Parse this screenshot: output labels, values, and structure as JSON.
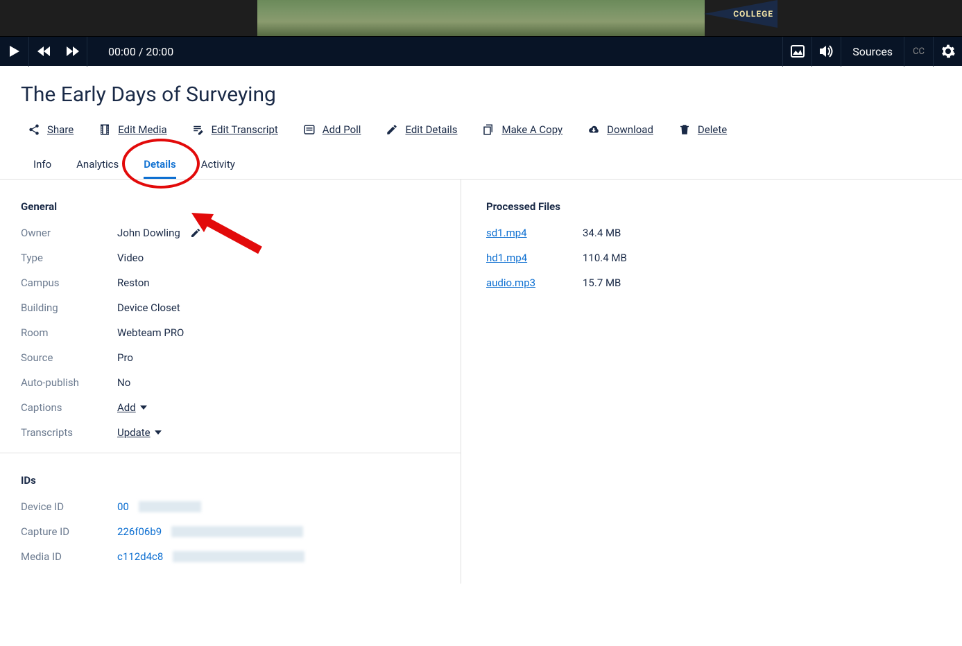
{
  "thumb": {
    "pennant": "COLLEGE"
  },
  "player": {
    "time": "00:00 / 20:00",
    "sources": "Sources",
    "cc": "CC"
  },
  "title": "The Early Days of Surveying",
  "actions": {
    "share": "Share",
    "edit_media": "Edit Media",
    "edit_transcript": "Edit Transcript",
    "add_poll": "Add Poll",
    "edit_details": "Edit Details",
    "make_copy": "Make A Copy",
    "download": "Download",
    "delete": "Delete"
  },
  "tabs": {
    "info": "Info",
    "analytics": "Analytics",
    "details": "Details",
    "activity": "Activity"
  },
  "general": {
    "heading": "General",
    "owner_label": "Owner",
    "owner_value": "John Dowling",
    "type_label": "Type",
    "type_value": "Video",
    "campus_label": "Campus",
    "campus_value": "Reston",
    "building_label": "Building",
    "building_value": "Device Closet",
    "room_label": "Room",
    "room_value": "Webteam PRO",
    "source_label": "Source",
    "source_value": "Pro",
    "autopub_label": "Auto-publish",
    "autopub_value": "No",
    "captions_label": "Captions",
    "captions_action": "Add",
    "transcripts_label": "Transcripts",
    "transcripts_action": "Update"
  },
  "files": {
    "heading": "Processed Files",
    "items": [
      {
        "name": "sd1.mp4",
        "size": "34.4 MB"
      },
      {
        "name": "hd1.mp4",
        "size": "110.4 MB"
      },
      {
        "name": "audio.mp3",
        "size": "15.7 MB"
      }
    ]
  },
  "ids": {
    "heading": "IDs",
    "device_label": "Device ID",
    "device_value": "00",
    "capture_label": "Capture ID",
    "capture_value": "226f06b9",
    "media_label": "Media ID",
    "media_value": "c112d4c8"
  }
}
